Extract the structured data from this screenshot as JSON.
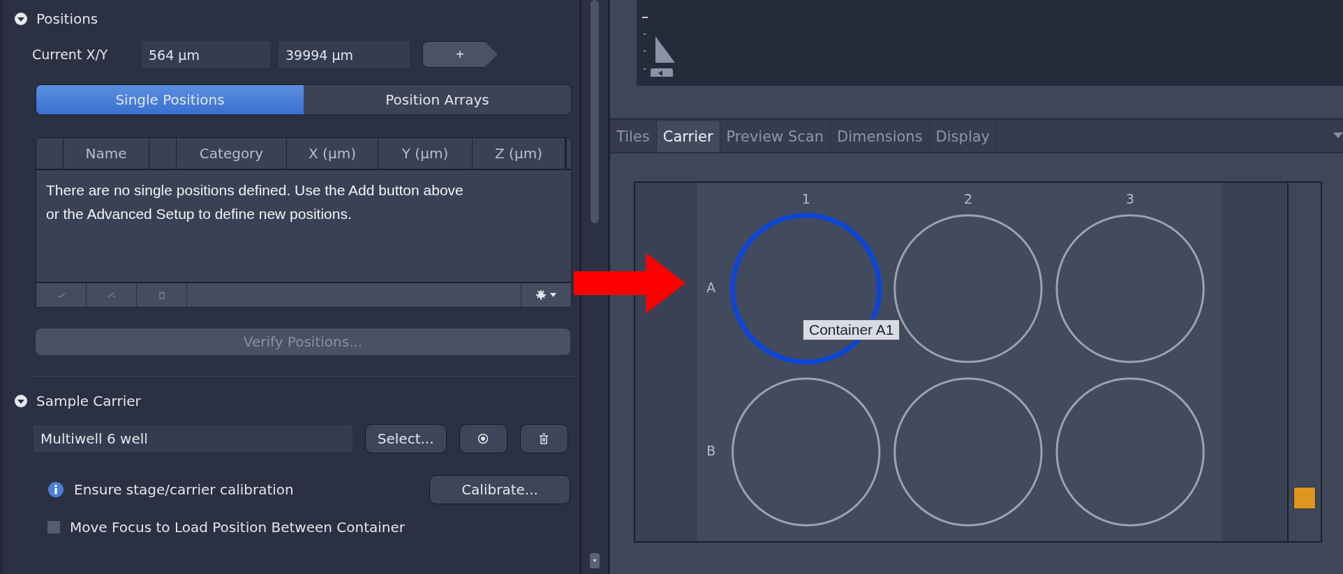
{
  "positions_panel": {
    "title": "Positions",
    "expanded": true,
    "current_label": "Current X/Y",
    "x_value": "564 µm",
    "y_value": "39994 µm",
    "add_button": "+",
    "tabs": [
      {
        "label": "Single Positions",
        "selected": true
      },
      {
        "label": "Position Arrays",
        "selected": false
      }
    ],
    "table": {
      "columns": [
        "Name",
        "Category",
        "X (µm)",
        "Y (µm)",
        "Z (µm)"
      ],
      "empty_message": "There are no single positions defined. Use the Add button above or the Advanced Setup to define new positions."
    },
    "verify_button": {
      "label": "Verify Positions...",
      "disabled": true
    }
  },
  "sample_carrier": {
    "title": "Sample Carrier",
    "expanded": true,
    "carrier_name": "Multiwell 6 well",
    "select_button": "Select...",
    "info": "Ensure stage/carrier calibration",
    "calibrate_button": "Calibrate...",
    "checkbox": {
      "label": "Move Focus to Load Position Between Container",
      "checked": false
    }
  },
  "view_tabs": [
    {
      "label": "Tiles",
      "selected": false
    },
    {
      "label": "Carrier",
      "selected": true
    },
    {
      "label": "Preview Scan",
      "selected": false
    },
    {
      "label": "Dimensions",
      "selected": false
    },
    {
      "label": "Display",
      "selected": false
    }
  ],
  "carrier_view": {
    "columns": [
      "1",
      "2",
      "3"
    ],
    "rows": [
      "A",
      "B"
    ],
    "wells": [
      {
        "selected": true
      },
      {
        "selected": false
      },
      {
        "selected": false
      },
      {
        "selected": false
      },
      {
        "selected": false
      },
      {
        "selected": false
      }
    ],
    "tooltip": "Container A1"
  }
}
